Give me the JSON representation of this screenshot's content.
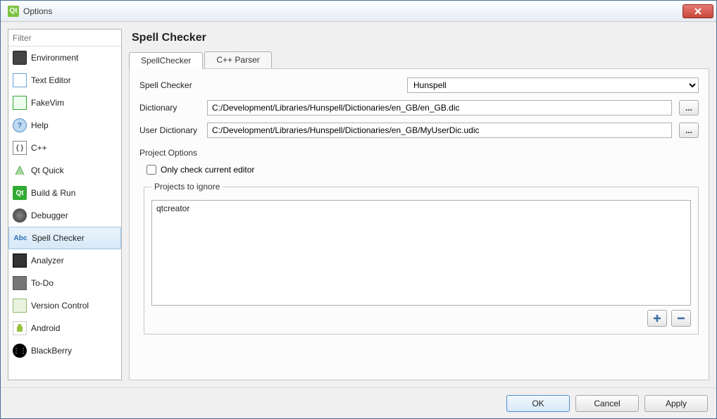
{
  "window": {
    "title": "Options"
  },
  "filter": {
    "placeholder": "Filter"
  },
  "sidebar": {
    "items": [
      {
        "label": "Environment"
      },
      {
        "label": "Text Editor"
      },
      {
        "label": "FakeVim"
      },
      {
        "label": "Help"
      },
      {
        "label": "C++"
      },
      {
        "label": "Qt Quick"
      },
      {
        "label": "Build & Run"
      },
      {
        "label": "Debugger"
      },
      {
        "label": "Spell Checker"
      },
      {
        "label": "Analyzer"
      },
      {
        "label": "To-Do"
      },
      {
        "label": "Version Control"
      },
      {
        "label": "Android"
      },
      {
        "label": "BlackBerry"
      }
    ]
  },
  "page": {
    "title": "Spell Checker"
  },
  "tabs": [
    {
      "label": "SpellChecker"
    },
    {
      "label": "C++ Parser"
    }
  ],
  "form": {
    "spell_checker_label": "Spell Checker",
    "spell_checker_value": "Hunspell",
    "dictionary_label": "Dictionary",
    "dictionary_value": "C:/Development/Libraries/Hunspell/Dictionaries/en_GB/en_GB.dic",
    "user_dictionary_label": "User Dictionary",
    "user_dictionary_value": "C:/Development/Libraries/Hunspell/Dictionaries/en_GB/MyUserDic.udic",
    "browse_label": "..."
  },
  "project_options": {
    "title": "Project Options",
    "only_check_label": "Only check current editor",
    "projects_to_ignore_label": "Projects to ignore",
    "items": [
      {
        "name": "qtcreator"
      }
    ]
  },
  "buttons": {
    "ok": "OK",
    "cancel": "Cancel",
    "apply": "Apply"
  },
  "icons": {
    "help_q": "?",
    "cpp": "{ }",
    "build": "Qt",
    "spell": "Abc",
    "android": "◉",
    "bb": "⋮⋮"
  }
}
